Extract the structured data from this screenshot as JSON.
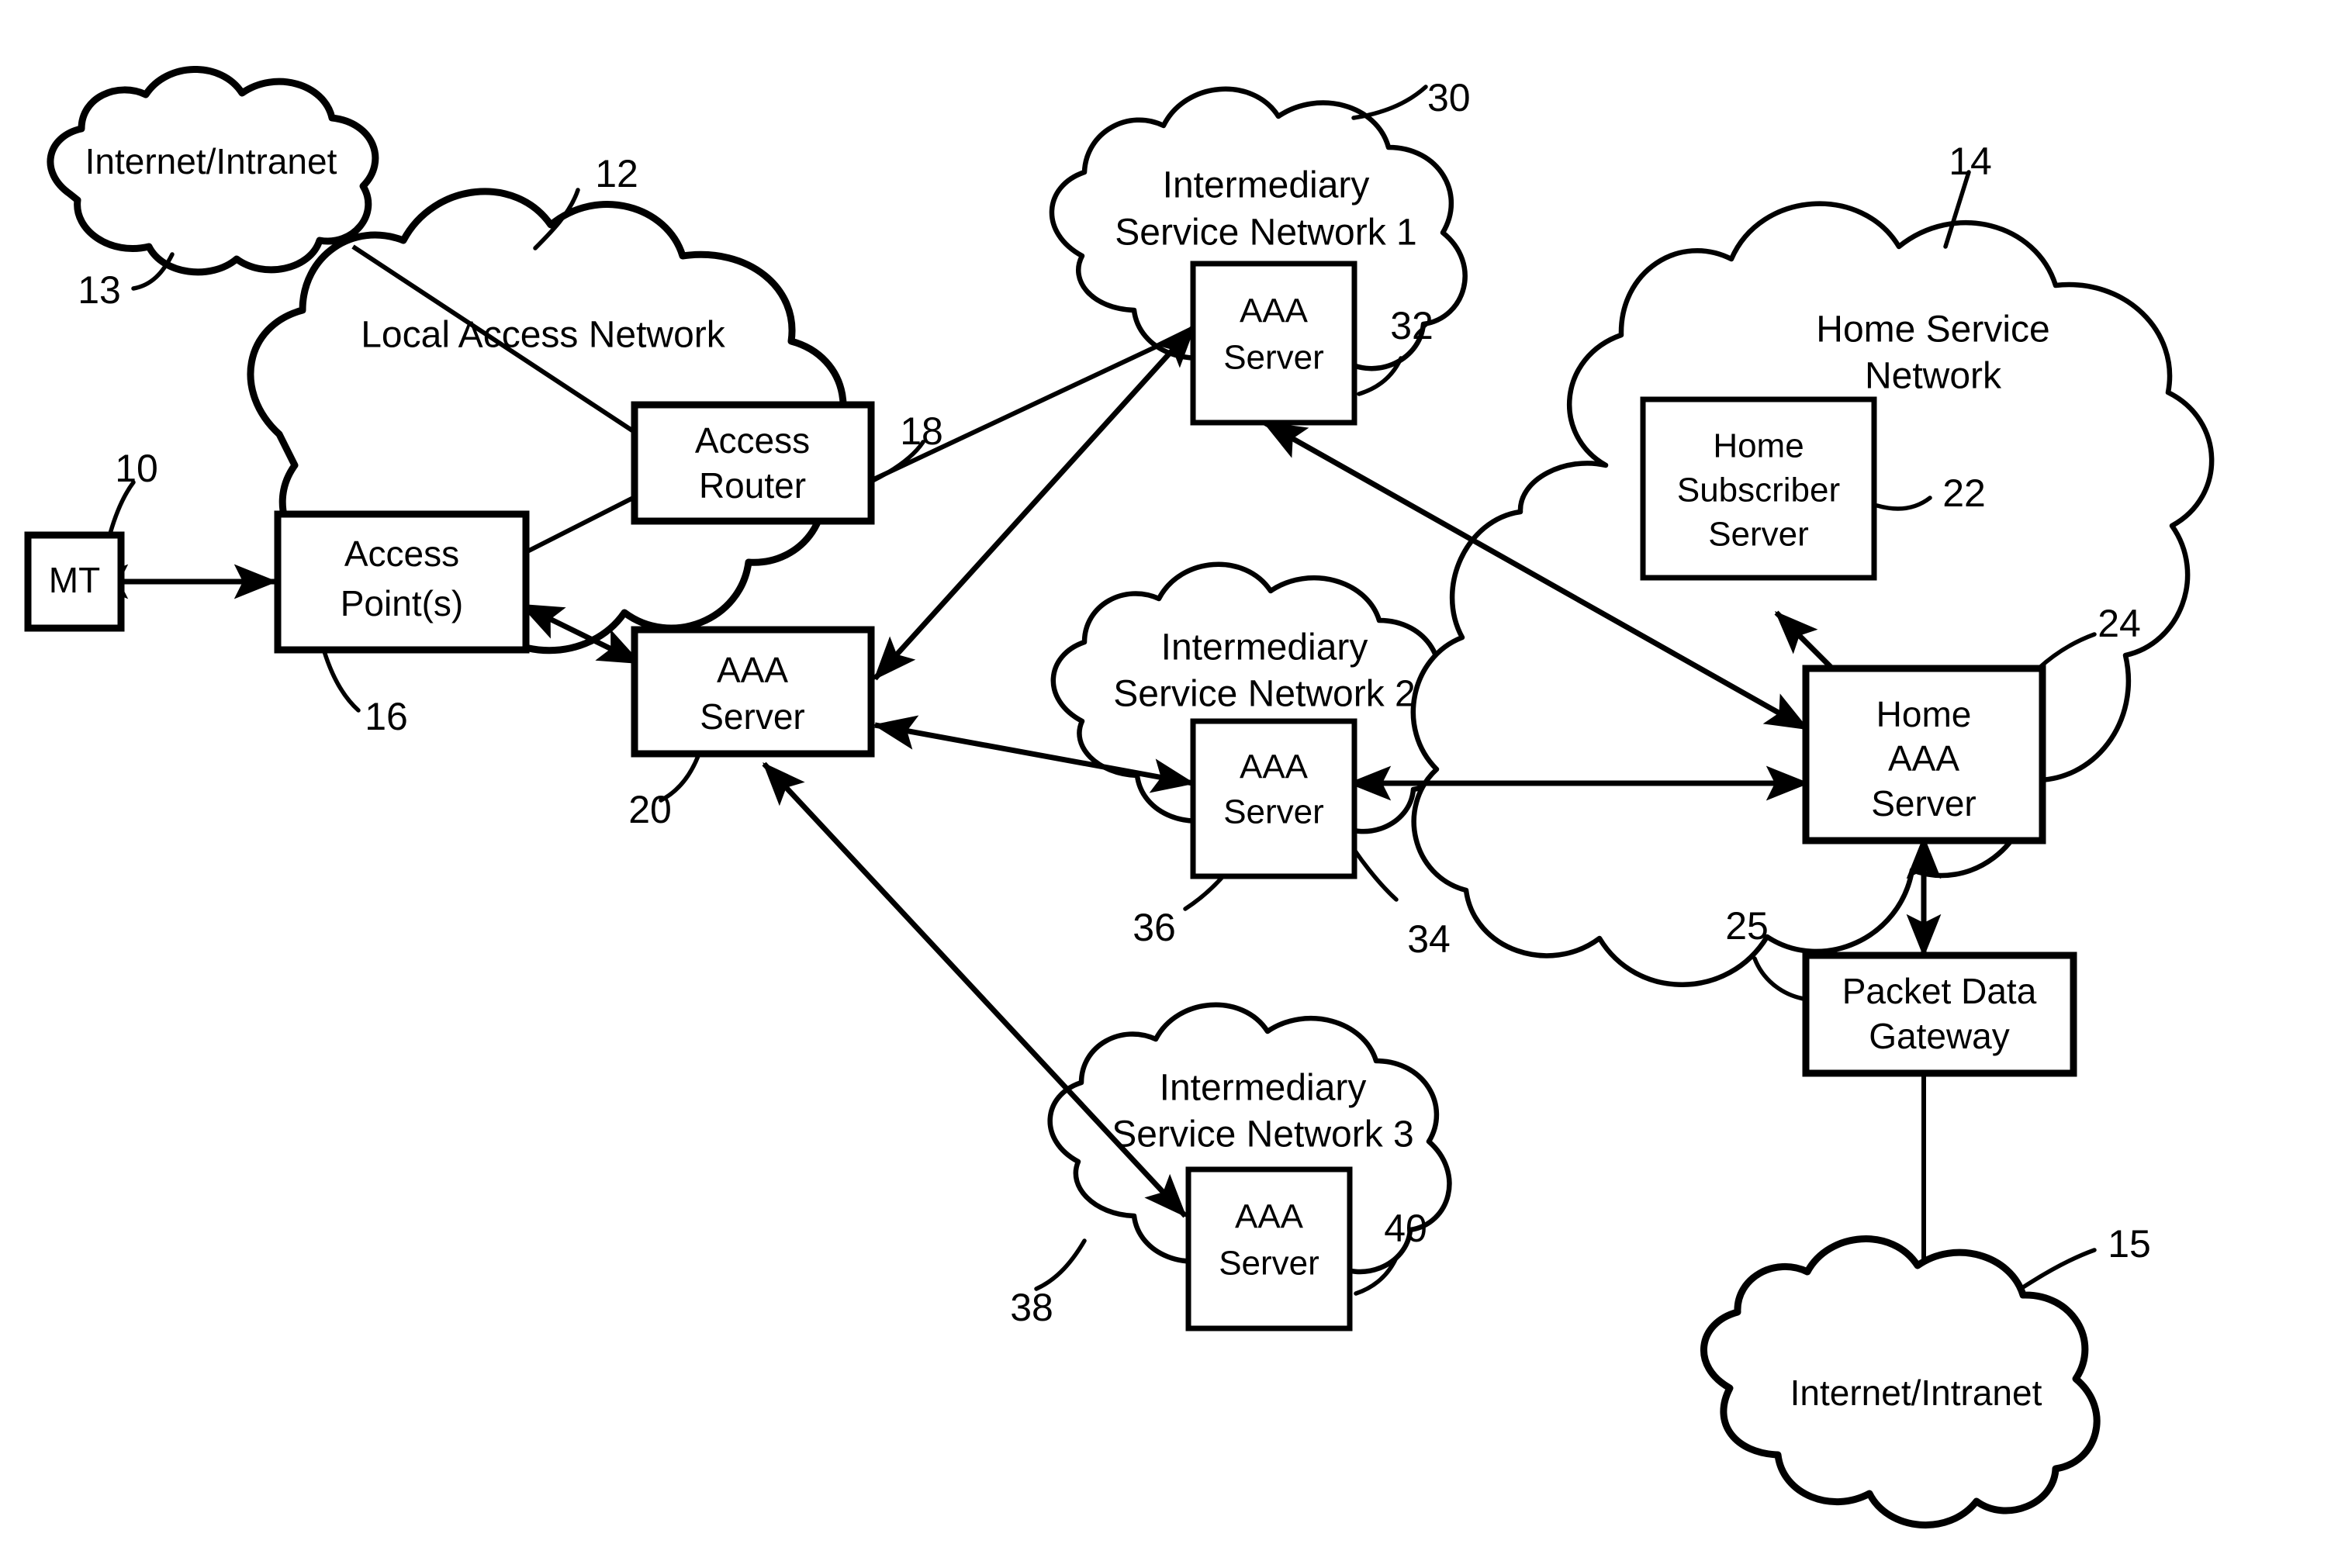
{
  "figure": {
    "type": "patent-network-diagram",
    "background": "#ffffff",
    "line_color": "#000000"
  },
  "clouds": [
    {
      "id": "internet_top",
      "title_line1": "Internet/Intranet",
      "title_line2": "",
      "ref": "13"
    },
    {
      "id": "local_access",
      "title_line1": "Local Access Network",
      "title_line2": "",
      "ref": "12"
    },
    {
      "id": "isn1",
      "title_line1": "Intermediary",
      "title_line2": "Service Network 1",
      "ref": "30"
    },
    {
      "id": "isn2",
      "title_line1": "Intermediary",
      "title_line2": "Service Network 2",
      "ref": "34"
    },
    {
      "id": "isn3",
      "title_line1": "Intermediary",
      "title_line2": "Service Network 3",
      "ref": "38"
    },
    {
      "id": "home_service",
      "title_line1": "Home Service",
      "title_line2": "Network",
      "ref": "14"
    },
    {
      "id": "internet_bottom",
      "title_line1": "Internet/Intranet",
      "title_line2": "",
      "ref": "15"
    }
  ],
  "boxes": [
    {
      "id": "mt",
      "line1": "MT",
      "line2": "",
      "line3": "",
      "ref": "10"
    },
    {
      "id": "ap",
      "line1": "Access",
      "line2": "Point(s)",
      "line3": "",
      "ref": "16"
    },
    {
      "id": "ar",
      "line1": "Access",
      "line2": "Router",
      "line3": "",
      "ref": "18"
    },
    {
      "id": "laaa",
      "line1": "AAA",
      "line2": "Server",
      "line3": "",
      "ref": "20"
    },
    {
      "id": "aaa1",
      "line1": "AAA",
      "line2": "Server",
      "line3": "",
      "ref": "32"
    },
    {
      "id": "aaa2",
      "line1": "AAA",
      "line2": "Server",
      "line3": "",
      "ref": "36"
    },
    {
      "id": "aaa3",
      "line1": "AAA",
      "line2": "Server",
      "line3": "",
      "ref": "40"
    },
    {
      "id": "hss",
      "line1": "Home",
      "line2": "Subscriber",
      "line3": "Server",
      "ref": "22"
    },
    {
      "id": "haaa",
      "line1": "Home",
      "line2": "AAA",
      "line3": "Server",
      "ref": "24"
    },
    {
      "id": "pdg",
      "line1": "Packet Data",
      "line2": "Gateway",
      "line3": "",
      "ref": "25"
    }
  ],
  "connections": [
    {
      "from": "internet_top",
      "to": "ar",
      "arrows": "none"
    },
    {
      "from": "mt",
      "to": "ap",
      "arrows": "both"
    },
    {
      "from": "ap",
      "to": "ar",
      "arrows": "none"
    },
    {
      "from": "ap",
      "to": "laaa",
      "arrows": "both"
    },
    {
      "from": "ar",
      "to": "aaa1",
      "arrows": "none"
    },
    {
      "from": "laaa",
      "to": "aaa1",
      "arrows": "both"
    },
    {
      "from": "laaa",
      "to": "aaa2",
      "arrows": "both"
    },
    {
      "from": "laaa",
      "to": "aaa3",
      "arrows": "both"
    },
    {
      "from": "aaa1",
      "to": "haaa",
      "arrows": "both"
    },
    {
      "from": "aaa2",
      "to": "haaa",
      "arrows": "both"
    },
    {
      "from": "haaa",
      "to": "hss",
      "arrows": "start"
    },
    {
      "from": "haaa",
      "to": "pdg",
      "arrows": "both"
    },
    {
      "from": "pdg",
      "to": "internet_bottom",
      "arrows": "none"
    }
  ]
}
